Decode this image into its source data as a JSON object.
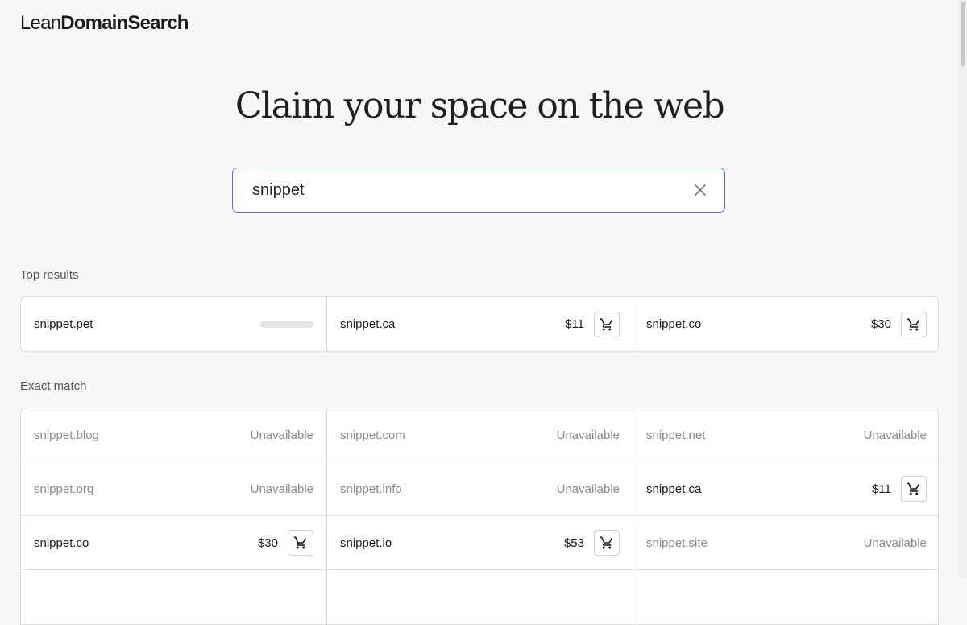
{
  "logo": {
    "light": "Lean",
    "bold": "DomainSearch"
  },
  "headline": "Claim your space on the web",
  "search": {
    "value": "snippet"
  },
  "top_results": {
    "label": "Top results",
    "items": [
      {
        "domain": "snippet.pet",
        "state": "loading"
      },
      {
        "domain": "snippet.ca",
        "price": "$11",
        "state": "available"
      },
      {
        "domain": "snippet.co",
        "price": "$30",
        "state": "available"
      }
    ]
  },
  "exact_match": {
    "label": "Exact match",
    "items": [
      {
        "domain": "snippet.blog",
        "status": "Unavailable",
        "state": "unavailable"
      },
      {
        "domain": "snippet.com",
        "status": "Unavailable",
        "state": "unavailable"
      },
      {
        "domain": "snippet.net",
        "status": "Unavailable",
        "state": "unavailable"
      },
      {
        "domain": "snippet.org",
        "status": "Unavailable",
        "state": "unavailable"
      },
      {
        "domain": "snippet.info",
        "status": "Unavailable",
        "state": "unavailable"
      },
      {
        "domain": "snippet.ca",
        "price": "$11",
        "state": "available"
      },
      {
        "domain": "snippet.co",
        "price": "$30",
        "state": "available"
      },
      {
        "domain": "snippet.io",
        "price": "$53",
        "state": "available"
      },
      {
        "domain": "snippet.site",
        "status": "Unavailable",
        "state": "unavailable"
      }
    ]
  },
  "colors": {
    "accent": "#5b6fd8",
    "border": "#dcdcdc",
    "muted": "#8a8a8a"
  },
  "icons": {
    "clear": "close-icon",
    "cart": "cart-icon"
  }
}
